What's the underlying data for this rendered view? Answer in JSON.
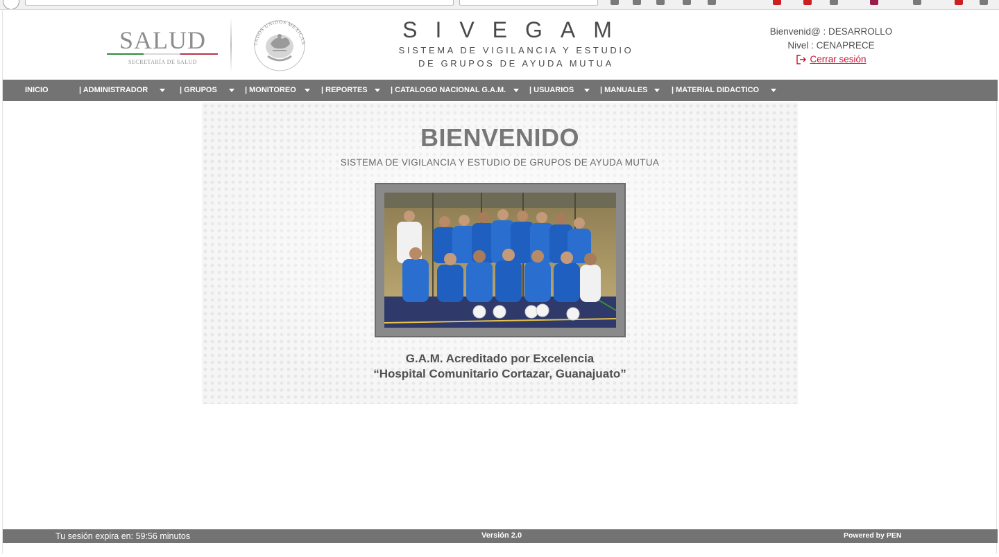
{
  "header": {
    "logo_text": "SALUD",
    "logo_subtext": "SECRETARÍA DE SALUD",
    "seal_text": "ESTADOS UNIDOS MEXICANOS",
    "system_acronym": "SIVEGAM",
    "system_name_line1": "SISTEMA DE VIGILANCIA Y ESTUDIO",
    "system_name_line2": "DE GRUPOS DE AYUDA MUTUA",
    "welcome_user": "Bienvenid@ : DESARROLLO",
    "user_level": "Nivel : CENAPRECE",
    "logout_label": "Cerrar sesión",
    "logout_icon": "exit-icon"
  },
  "menu": [
    {
      "label": "INICIO",
      "has_caret": false
    },
    {
      "label": "| ADMINISTRADOR",
      "has_caret": true
    },
    {
      "label": "| GRUPOS",
      "has_caret": true
    },
    {
      "label": "| MONITOREO",
      "has_caret": true
    },
    {
      "label": "| REPORTES",
      "has_caret": true
    },
    {
      "label": "| CATALOGO NACIONAL G.A.M.",
      "has_caret": true
    },
    {
      "label": "| USUARIOS",
      "has_caret": true
    },
    {
      "label": "| MANUALES",
      "has_caret": true
    },
    {
      "label": "| MATERIAL DIDACTICO",
      "has_caret": true
    }
  ],
  "main": {
    "title": "BIENVENIDO",
    "subtitle": "SISTEMA DE VIGILANCIA Y ESTUDIO DE GRUPOS DE AYUDA MUTUA",
    "caption_line1": "G.A.M. Acreditado por Excelencia",
    "caption_line2": "“Hospital Comunitario Cortazar, Guanajuato”"
  },
  "footer": {
    "session_prefix": "Tu sesión expira en:",
    "session_time": "59:56",
    "session_unit": "minutos",
    "version": "Versión 2.0",
    "powered_by": "Powered by PEN"
  },
  "colors": {
    "menu_bg": "#737373",
    "logout_red": "#c8102e",
    "text_gray": "#4a4a4a"
  }
}
